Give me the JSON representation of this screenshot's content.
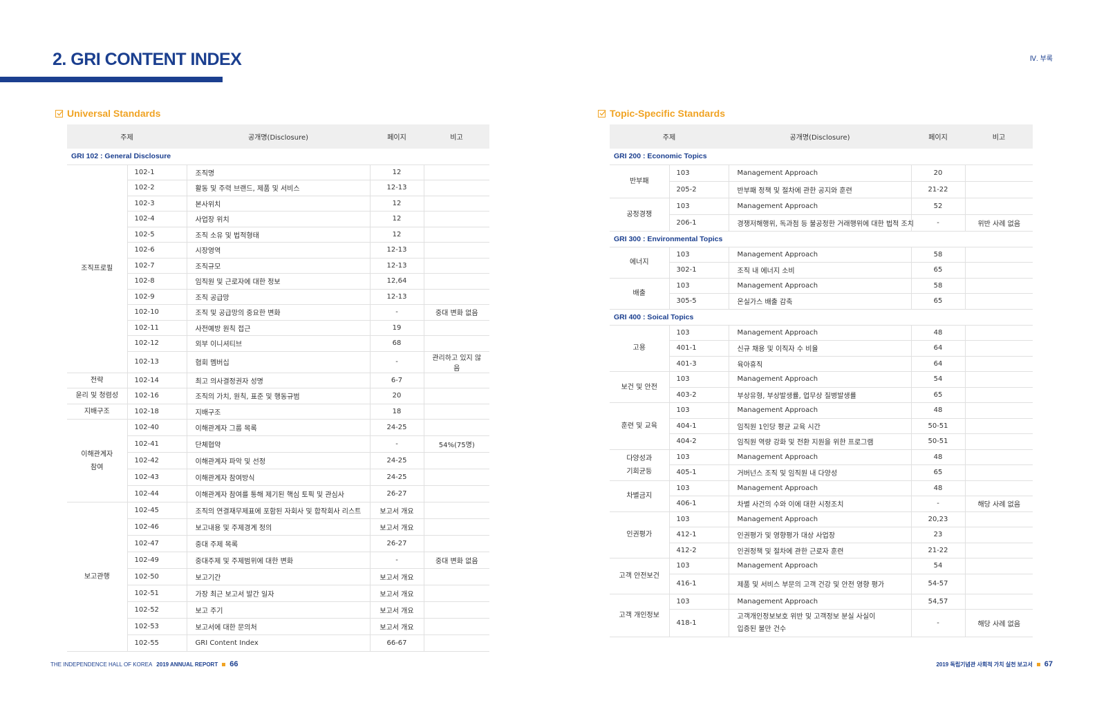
{
  "header": {
    "title": "2. GRI CONTENT INDEX",
    "section_label": "Ⅳ. 부록"
  },
  "left": {
    "heading": "Universal Standards",
    "columns": [
      "주제",
      "공개명(Disclosure)",
      "페이지",
      "비고"
    ],
    "group_title": "GRI 102 : General Disclosure",
    "topics": [
      "조직프로필",
      "전략",
      "윤리 및 청렴성",
      "지배구조",
      "이해관계자\n참여",
      "보고관행"
    ],
    "rows": [
      {
        "code": "102-1",
        "disc": "조직명",
        "page": "12",
        "note": ""
      },
      {
        "code": "102-2",
        "disc": "활동 및 주력 브랜드, 제품 및 서비스",
        "page": "12-13",
        "note": ""
      },
      {
        "code": "102-3",
        "disc": "본사위치",
        "page": "12",
        "note": ""
      },
      {
        "code": "102-4",
        "disc": "사업장 위치",
        "page": "12",
        "note": ""
      },
      {
        "code": "102-5",
        "disc": "조직 소유 및 법적형태",
        "page": "12",
        "note": ""
      },
      {
        "code": "102-6",
        "disc": "시장영역",
        "page": "12-13",
        "note": ""
      },
      {
        "code": "102-7",
        "disc": "조직규모",
        "page": "12-13",
        "note": ""
      },
      {
        "code": "102-8",
        "disc": "임직원 및 근로자에 대한 정보",
        "page": "12,64",
        "note": ""
      },
      {
        "code": "102-9",
        "disc": "조직 공급망",
        "page": "12-13",
        "note": ""
      },
      {
        "code": "102-10",
        "disc": "조직 및 공급망의 중요한 변화",
        "page": "-",
        "note": "중대 변화 없음"
      },
      {
        "code": "102-11",
        "disc": "사전예방 원칙 접근",
        "page": "19",
        "note": ""
      },
      {
        "code": "102-12",
        "disc": "외부 이니셔티브",
        "page": "68",
        "note": ""
      },
      {
        "code": "102-13",
        "disc": "협회 멤버십",
        "page": "-",
        "note": "관리하고 있지 않음"
      },
      {
        "code": "102-14",
        "disc": "최고 의사결정권자 성명",
        "page": "6-7",
        "note": ""
      },
      {
        "code": "102-16",
        "disc": "조직의 가치, 원칙, 표준 및 행동규범",
        "page": "20",
        "note": ""
      },
      {
        "code": "102-18",
        "disc": "지배구조",
        "page": "18",
        "note": ""
      },
      {
        "code": "102-40",
        "disc": "이해관계자 그룹 목록",
        "page": "24-25",
        "note": ""
      },
      {
        "code": "102-41",
        "disc": "단체협약",
        "page": "-",
        "note": "54%(75명)"
      },
      {
        "code": "102-42",
        "disc": "이해관계자 파악 및 선정",
        "page": "24-25",
        "note": ""
      },
      {
        "code": "102-43",
        "disc": "이해관계자 참여방식",
        "page": "24-25",
        "note": ""
      },
      {
        "code": "102-44",
        "disc": "이해관계자 참여를 통해 제기된 핵심 토픽 및 관심사",
        "page": "26-27",
        "note": ""
      },
      {
        "code": "102-45",
        "disc": "조직의 연결재무제표에 포함된 자회사 및 합작회사 리스트",
        "page": "보고서 개요",
        "note": ""
      },
      {
        "code": "102-46",
        "disc": "보고내용 및 주제경계 정의",
        "page": "보고서 개요",
        "note": ""
      },
      {
        "code": "102-47",
        "disc": "중대 주제 목록",
        "page": "26-27",
        "note": ""
      },
      {
        "code": "102-49",
        "disc": "중대주제 및 주제범위에 대한 변화",
        "page": "-",
        "note": "중대 변화 없음"
      },
      {
        "code": "102-50",
        "disc": "보고기간",
        "page": "보고서 개요",
        "note": ""
      },
      {
        "code": "102-51",
        "disc": "가장 최근 보고서 발간 일자",
        "page": "보고서 개요",
        "note": ""
      },
      {
        "code": "102-52",
        "disc": "보고 주기",
        "page": "보고서 개요",
        "note": ""
      },
      {
        "code": "102-53",
        "disc": "보고서에 대한 문의처",
        "page": "보고서 개요",
        "note": ""
      },
      {
        "code": "102-55",
        "disc": "GRI Content Index",
        "page": "66-67",
        "note": ""
      }
    ]
  },
  "right": {
    "heading": "Topic-Specific Standards",
    "columns": [
      "주제",
      "공개명(Disclosure)",
      "페이지",
      "비고"
    ],
    "groups": [
      "GRI 200 : Economic Topics",
      "GRI 300 : Environmental Topics",
      "GRI 400 : Soical Topics"
    ],
    "topics": [
      "반부패",
      "공정경쟁",
      "에너지",
      "배출",
      "고용",
      "보건 및 안전",
      "훈련 및 교육",
      "다양성과\n기회균등",
      "차별금지",
      "인권평가",
      "고객 안전보건",
      "고객 개인정보"
    ],
    "rows": [
      {
        "code": "103",
        "disc": "Management Approach",
        "page": "20",
        "note": ""
      },
      {
        "code": "205-2",
        "disc": "반부패 정책 및 절차에 관한 공지와 훈련",
        "page": "21-22",
        "note": ""
      },
      {
        "code": "103",
        "disc": "Management Approach",
        "page": "52",
        "note": ""
      },
      {
        "code": "206-1",
        "disc": "경쟁저해행위, 독과점 등 불공정한 거래행위에 대한 법적 조치",
        "page": "-",
        "note": "위반 사례 없음"
      },
      {
        "code": "103",
        "disc": "Management Approach",
        "page": "58",
        "note": ""
      },
      {
        "code": "302-1",
        "disc": "조직 내 에너지 소비",
        "page": "65",
        "note": ""
      },
      {
        "code": "103",
        "disc": "Management Approach",
        "page": "58",
        "note": ""
      },
      {
        "code": "305-5",
        "disc": "온실가스 배출 감축",
        "page": "65",
        "note": ""
      },
      {
        "code": "103",
        "disc": "Management Approach",
        "page": "48",
        "note": ""
      },
      {
        "code": "401-1",
        "disc": "신규 채용 및 이직자 수 비율",
        "page": "64",
        "note": ""
      },
      {
        "code": "401-3",
        "disc": "육아휴직",
        "page": "64",
        "note": ""
      },
      {
        "code": "103",
        "disc": "Management Approach",
        "page": "54",
        "note": ""
      },
      {
        "code": "403-2",
        "disc": "부상유형, 부상발생률, 업무상 질병발생률",
        "page": "65",
        "note": ""
      },
      {
        "code": "103",
        "disc": "Management Approach",
        "page": "48",
        "note": ""
      },
      {
        "code": "404-1",
        "disc": "임직원 1인당 평균 교육 시간",
        "page": "50-51",
        "note": ""
      },
      {
        "code": "404-2",
        "disc": "임직원 역량 강화 및 전환 지원을 위한 프로그램",
        "page": "50-51",
        "note": ""
      },
      {
        "code": "103",
        "disc": "Management Approach",
        "page": "48",
        "note": ""
      },
      {
        "code": "405-1",
        "disc": "거버넌스 조직 및 임직원 내 다양성",
        "page": "65",
        "note": ""
      },
      {
        "code": "103",
        "disc": "Management Approach",
        "page": "48",
        "note": ""
      },
      {
        "code": "406-1",
        "disc": "차별 사건의 수와 이에 대한 시정조치",
        "page": "-",
        "note": "해당 사례 없음"
      },
      {
        "code": "103",
        "disc": "Management Approach",
        "page": "20,23",
        "note": ""
      },
      {
        "code": "412-1",
        "disc": "인권평가 및 영향평가 대상 사업장",
        "page": "23",
        "note": ""
      },
      {
        "code": "412-2",
        "disc": "인권정책 및 절차에 관한 근로자 훈련",
        "page": "21-22",
        "note": ""
      },
      {
        "code": "103",
        "disc": "Management Approach",
        "page": "54",
        "note": ""
      },
      {
        "code": "416-1",
        "disc": "제품 및 서비스 부문의 고객 건강 및 안전 영향 평가",
        "page": "54-57",
        "note": ""
      },
      {
        "code": "103",
        "disc": "Management Approach",
        "page": "54,57",
        "note": ""
      },
      {
        "code": "418-1",
        "disc": "고객개인정보보호 위반 및 고객정보 분실 사실이\n입증된 불만 건수",
        "page": "-",
        "note": "해당 사례 없음"
      }
    ]
  },
  "footer": {
    "left_org": "THE INDEPENDENCE HALL OF KOREA",
    "left_report": "2019 ANNUAL REPORT",
    "left_page": "66",
    "right_report": "2019 독립기념관 사회적 가치 실천 보고서",
    "right_page": "67"
  }
}
